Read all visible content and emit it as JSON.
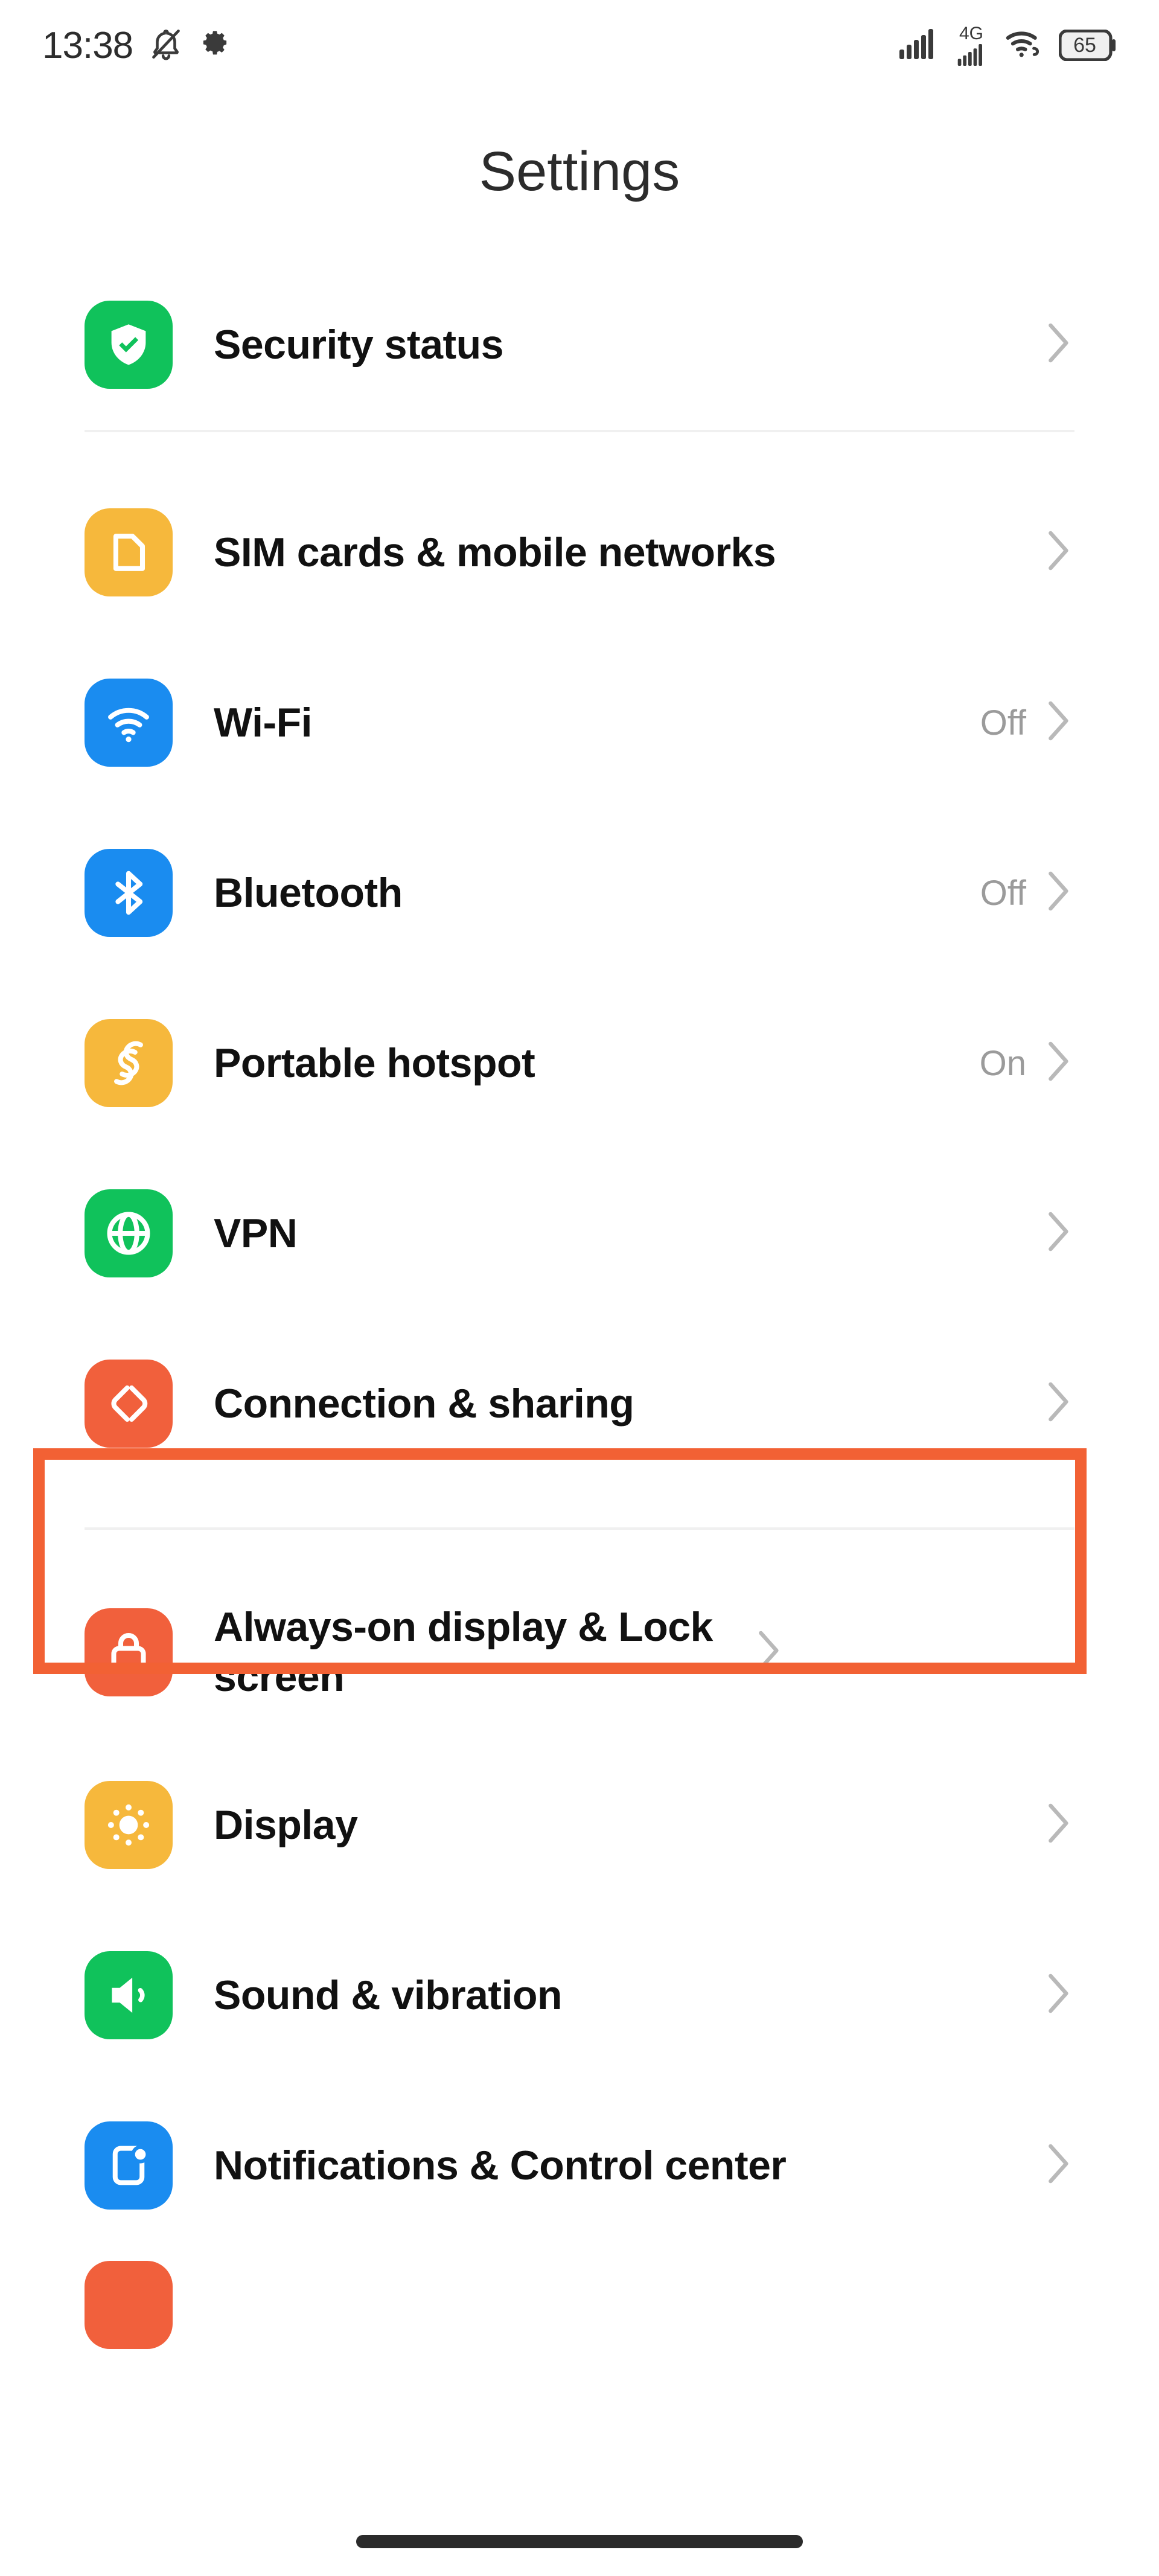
{
  "status_bar": {
    "time": "13:38",
    "left_icons": [
      "bell-muted-icon",
      "gear-icon"
    ],
    "network_label": "4G",
    "battery_level": "65",
    "right_icons": [
      "signal-bars-icon",
      "signal-bars-4g-icon",
      "wifi-hotspot-icon",
      "battery-icon"
    ]
  },
  "header": {
    "title": "Settings"
  },
  "colors": {
    "green": "#10c25b",
    "amber": "#f6b83c",
    "blue": "#1a8cf0",
    "orange_red": "#f1603c",
    "highlight": "#f26134",
    "value_gray": "#9b9b9b",
    "divider": "#f0f0f0"
  },
  "groups": [
    {
      "id": "group-security",
      "items": [
        {
          "label": "Security status",
          "value": "",
          "icon": "shield-check-icon",
          "icon_color": "#10c25b",
          "chevron": true,
          "highlighted": false,
          "two_line": false
        }
      ]
    },
    {
      "id": "group-network",
      "items": [
        {
          "label": "SIM cards & mobile networks",
          "value": "",
          "icon": "sim-card-icon",
          "icon_color": "#f6b83c",
          "chevron": true,
          "highlighted": false,
          "two_line": false
        },
        {
          "label": "Wi-Fi",
          "value": "Off",
          "icon": "wifi-icon",
          "icon_color": "#1a8cf0",
          "chevron": true,
          "highlighted": false,
          "two_line": false
        },
        {
          "label": "Bluetooth",
          "value": "Off",
          "icon": "bluetooth-icon",
          "icon_color": "#1a8cf0",
          "chevron": true,
          "highlighted": false,
          "two_line": false
        },
        {
          "label": "Portable hotspot",
          "value": "On",
          "icon": "hotspot-icon",
          "icon_color": "#f6b83c",
          "chevron": true,
          "highlighted": false,
          "two_line": false
        },
        {
          "label": "VPN",
          "value": "",
          "icon": "globe-icon",
          "icon_color": "#10c25b",
          "chevron": true,
          "highlighted": false,
          "two_line": false
        },
        {
          "label": "Connection & sharing",
          "value": "",
          "icon": "connection-sharing-icon",
          "icon_color": "#f1603c",
          "chevron": true,
          "highlighted": true,
          "two_line": false
        }
      ]
    },
    {
      "id": "group-display",
      "items": [
        {
          "label": "Always-on display & Lock screen",
          "value": "",
          "icon": "lock-icon",
          "icon_color": "#f1603c",
          "chevron": true,
          "highlighted": false,
          "two_line": true
        },
        {
          "label": "Display",
          "value": "",
          "icon": "brightness-icon",
          "icon_color": "#f6b83c",
          "chevron": true,
          "highlighted": false,
          "two_line": false
        },
        {
          "label": "Sound & vibration",
          "value": "",
          "icon": "speaker-icon",
          "icon_color": "#10c25b",
          "chevron": true,
          "highlighted": false,
          "two_line": false
        },
        {
          "label": "Notifications & Control center",
          "value": "",
          "icon": "notifications-icon",
          "icon_color": "#1a8cf0",
          "chevron": true,
          "highlighted": false,
          "two_line": false
        }
      ]
    }
  ],
  "partial_item": {
    "icon": "orange-app-icon",
    "icon_color": "#f1603c"
  },
  "navigation": {
    "home_indicator": "home-indicator-bar"
  }
}
